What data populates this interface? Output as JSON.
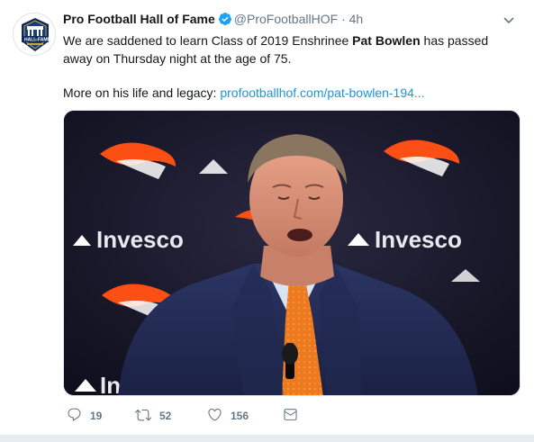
{
  "tweet": {
    "author_name": "Pro Football Hall of Fame",
    "handle": "@ProFootballHOF",
    "separator": "·",
    "time": "4h",
    "text_before": "We are saddened to learn Class of 2019 Enshrinee ",
    "text_bold": "Pat Bowlen",
    "text_after": " has passed away on Thursday night at the age of 75.",
    "more_label": "More on his life and legacy: ",
    "link_text": "profootballhof.com/pat-bowlen-194...",
    "avatar_text_top": "HALL",
    "avatar_text_bottom": "FAME",
    "avatar_text_of": "OF"
  },
  "media": {
    "backdrop_brand": "Invesco"
  },
  "actions": {
    "reply_count": "19",
    "retweet_count": "52",
    "like_count": "156"
  },
  "colors": {
    "link": "#1b95e0",
    "verified": "#1da1f2",
    "muted": "#657786",
    "broncos_orange": "#fb4f14",
    "navy": "#002244"
  }
}
